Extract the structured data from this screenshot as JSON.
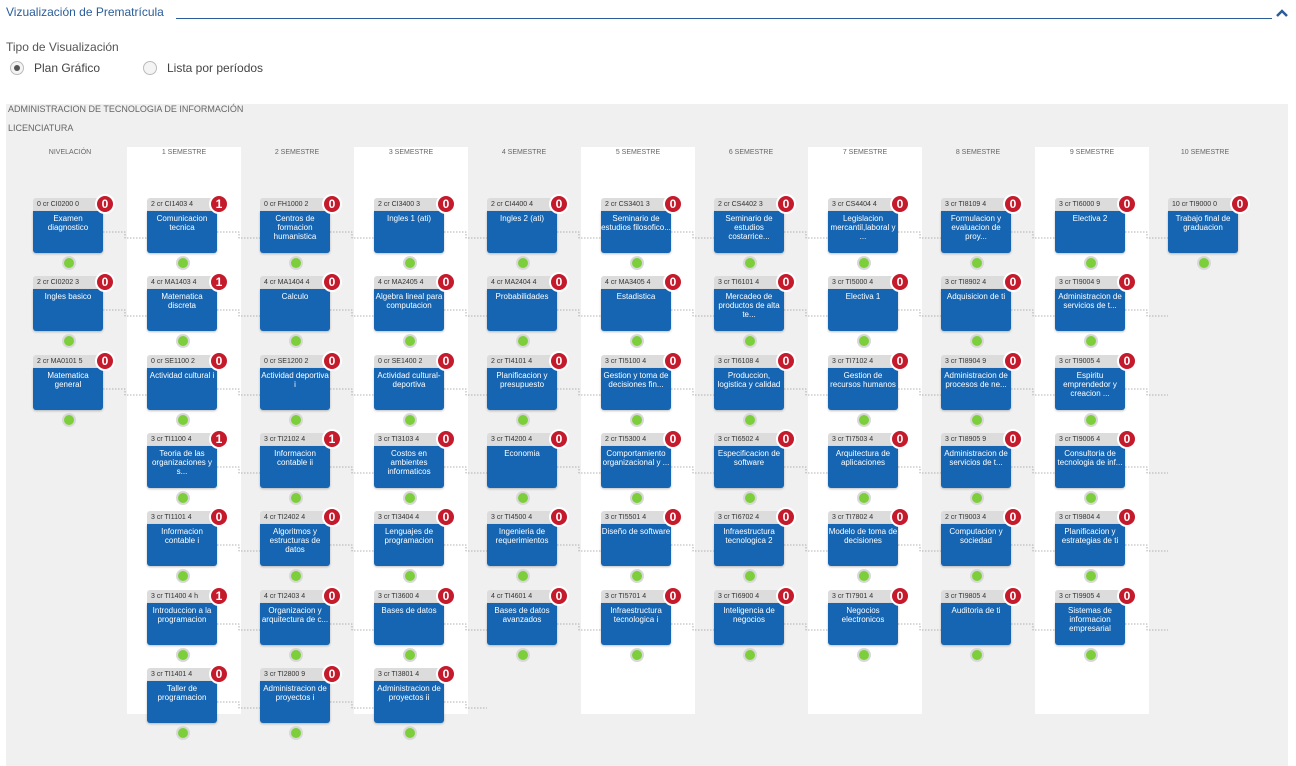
{
  "section": {
    "title": "Vizualización de Prematrícula"
  },
  "visualization": {
    "label": "Tipo de Visualización",
    "options": [
      {
        "label": "Plan Gráfico",
        "checked": true
      },
      {
        "label": "Lista por períodos",
        "checked": false
      }
    ]
  },
  "plan": {
    "name": "ADMINISTRACION DE TECNOLOGIA DE INFORMACIÓN",
    "level": "LICENCIATURA",
    "columns": [
      "NIVELACIÓN",
      "1 SEMESTRE",
      "2 SEMESTRE",
      "3 SEMESTRE",
      "4 SEMESTRE",
      "5 SEMESTRE",
      "6 SEMESTRE",
      "7 SEMESTRE",
      "8 SEMESTRE",
      "9 SEMESTRE",
      "10 SEMESTRE"
    ],
    "courses": [
      {
        "col": 0,
        "row": 0,
        "code": "0 cr  CI0200  0",
        "name": "Examen diagnostico",
        "badge": "0"
      },
      {
        "col": 0,
        "row": 1,
        "code": "2 cr  CI0202  3",
        "name": "Ingles basico",
        "badge": "0"
      },
      {
        "col": 0,
        "row": 2,
        "code": "2 cr  MA0101  5",
        "name": "Matematica general",
        "badge": "0"
      },
      {
        "col": 1,
        "row": 0,
        "code": "2 cr  CI1403  4",
        "name": "Comunicacion tecnica",
        "badge": "1"
      },
      {
        "col": 1,
        "row": 1,
        "code": "4 cr  MA1403  4",
        "name": "Matematica discreta",
        "badge": "1"
      },
      {
        "col": 1,
        "row": 2,
        "code": "0 cr  SE1100  2",
        "name": "Actividad cultural i",
        "badge": "0"
      },
      {
        "col": 1,
        "row": 3,
        "code": "3 cr  TI1100  4",
        "name": "Teoria de las organizaciones y s...",
        "badge": "1"
      },
      {
        "col": 1,
        "row": 4,
        "code": "3 cr  TI1101  4",
        "name": "Informacion contable i",
        "badge": "0"
      },
      {
        "col": 1,
        "row": 5,
        "code": "3 cr  TI1400  4 h",
        "name": "Introduccion a la programacion",
        "badge": "1"
      },
      {
        "col": 1,
        "row": 6,
        "code": "3 cr  TI1401  4",
        "name": "Taller de programacion",
        "badge": "0"
      },
      {
        "col": 2,
        "row": 0,
        "code": "0 cr  FH1000  2",
        "name": "Centros de formacion humanistica",
        "badge": "0"
      },
      {
        "col": 2,
        "row": 1,
        "code": "4 cr  MA1404  4",
        "name": "Calculo",
        "badge": "0"
      },
      {
        "col": 2,
        "row": 2,
        "code": "0 cr  SE1200  2",
        "name": "Actividad deportiva i",
        "badge": "0"
      },
      {
        "col": 2,
        "row": 3,
        "code": "3 cr  TI2102  4",
        "name": "Informacion contable ii",
        "badge": "1"
      },
      {
        "col": 2,
        "row": 4,
        "code": "4 cr  TI2402  4",
        "name": "Algoritmos y estructuras de datos",
        "badge": "0"
      },
      {
        "col": 2,
        "row": 5,
        "code": "4 cr  TI2403  4",
        "name": "Organizacion y arquitectura de c...",
        "badge": "0"
      },
      {
        "col": 2,
        "row": 6,
        "code": "3 cr  TI2800  9",
        "name": "Administracion de proyectos i",
        "badge": "0"
      },
      {
        "col": 3,
        "row": 0,
        "code": "2 cr  CI3400  3",
        "name": "Ingles 1 (ati)",
        "badge": "0"
      },
      {
        "col": 3,
        "row": 1,
        "code": "4 cr  MA2405  4",
        "name": "Algebra lineal para computacion",
        "badge": "0"
      },
      {
        "col": 3,
        "row": 2,
        "code": "0 cr  SE1400  2",
        "name": "Actividad cultural-deportiva",
        "badge": "0"
      },
      {
        "col": 3,
        "row": 3,
        "code": "3 cr  TI3103  4",
        "name": "Costos en ambientes informaticos",
        "badge": "0"
      },
      {
        "col": 3,
        "row": 4,
        "code": "3 cr  TI3404  4",
        "name": "Lenguajes de programacion",
        "badge": "0"
      },
      {
        "col": 3,
        "row": 5,
        "code": "3 cr  TI3600  4",
        "name": "Bases de datos",
        "badge": "0"
      },
      {
        "col": 3,
        "row": 6,
        "code": "3 cr  TI3801  4",
        "name": "Administracion de proyectos ii",
        "badge": "0"
      },
      {
        "col": 4,
        "row": 0,
        "code": "2 cr  CI4400  4",
        "name": "Ingles 2 (ati)",
        "badge": "0"
      },
      {
        "col": 4,
        "row": 1,
        "code": "4 cr  MA2404  4",
        "name": "Probabilidades",
        "badge": "0"
      },
      {
        "col": 4,
        "row": 2,
        "code": "2 cr  TI4101  4",
        "name": "Planificacion y presupuesto",
        "badge": "0"
      },
      {
        "col": 4,
        "row": 3,
        "code": "3 cr  TI4200  4",
        "name": "Economia",
        "badge": "0"
      },
      {
        "col": 4,
        "row": 4,
        "code": "3 cr  TI4500  4",
        "name": "Ingenieria de requerimientos",
        "badge": "0"
      },
      {
        "col": 4,
        "row": 5,
        "code": "4 cr  TI4601  4",
        "name": "Bases de datos avanzados",
        "badge": "0"
      },
      {
        "col": 5,
        "row": 0,
        "code": "2 cr  CS3401  3",
        "name": "Seminario de estudios filosofico...",
        "badge": "0"
      },
      {
        "col": 5,
        "row": 1,
        "code": "4 cr  MA3405  4",
        "name": "Estadistica",
        "badge": "0"
      },
      {
        "col": 5,
        "row": 2,
        "code": "3 cr  TI5100  4",
        "name": "Gestion y toma de decisiones fin...",
        "badge": "0"
      },
      {
        "col": 5,
        "row": 3,
        "code": "2 cr  TI5300  4",
        "name": "Comportamiento organizacional y ...",
        "badge": "0"
      },
      {
        "col": 5,
        "row": 4,
        "code": "3 cr  TI5501  4",
        "name": "Diseño de software",
        "badge": "0"
      },
      {
        "col": 5,
        "row": 5,
        "code": "3 cr  TI5701  4",
        "name": "Infraestructura tecnologica i",
        "badge": "0"
      },
      {
        "col": 6,
        "row": 0,
        "code": "2 cr  CS4402  3",
        "name": "Seminario de estudios costarrice...",
        "badge": "0"
      },
      {
        "col": 6,
        "row": 1,
        "code": "3 cr  TI6101  4",
        "name": "Mercadeo de productos de alta te...",
        "badge": "0"
      },
      {
        "col": 6,
        "row": 2,
        "code": "3 cr  TI6108  4",
        "name": "Produccion, logistica y calidad",
        "badge": "0"
      },
      {
        "col": 6,
        "row": 3,
        "code": "3 cr  TI6502  4",
        "name": "Especificacion de software",
        "badge": "0"
      },
      {
        "col": 6,
        "row": 4,
        "code": "3 cr  TI6702  4",
        "name": "Infraestructura tecnologica 2",
        "badge": "0"
      },
      {
        "col": 6,
        "row": 5,
        "code": "3 cr  TI6900  4",
        "name": "Inteligencia de negocios",
        "badge": "0"
      },
      {
        "col": 7,
        "row": 0,
        "code": "3 cr  CS4404  4",
        "name": "Legislacion mercantil,laboral y ...",
        "badge": "0"
      },
      {
        "col": 7,
        "row": 1,
        "code": "3 cr  TI5000  4",
        "name": "Electiva 1",
        "badge": "0"
      },
      {
        "col": 7,
        "row": 2,
        "code": "3 cr  TI7102  4",
        "name": "Gestion de recursos humanos",
        "badge": "0"
      },
      {
        "col": 7,
        "row": 3,
        "code": "3 cr  TI7503  4",
        "name": "Arquitectura de aplicaciones",
        "badge": "0"
      },
      {
        "col": 7,
        "row": 4,
        "code": "3 cr  TI7802  4",
        "name": "Modelo de toma de decisiones",
        "badge": "0"
      },
      {
        "col": 7,
        "row": 5,
        "code": "3 cr  TI7901  4",
        "name": "Negocios electronicos",
        "badge": "0"
      },
      {
        "col": 8,
        "row": 0,
        "code": "3 cr  TI8109  4",
        "name": "Formulacion y evaluacion de proy...",
        "badge": "0"
      },
      {
        "col": 8,
        "row": 1,
        "code": "3 cr  TI8902  4",
        "name": "Adquisicion de ti",
        "badge": "0"
      },
      {
        "col": 8,
        "row": 2,
        "code": "3 cr  TI8904  9",
        "name": "Administracion de procesos de ne...",
        "badge": "0"
      },
      {
        "col": 8,
        "row": 3,
        "code": "3 cr  TI8905  9",
        "name": "Administracion de servicios de t...",
        "badge": "0"
      },
      {
        "col": 8,
        "row": 4,
        "code": "2 cr  TI9003  4",
        "name": "Computacion y sociedad",
        "badge": "0"
      },
      {
        "col": 8,
        "row": 5,
        "code": "3 cr  TI9805  4",
        "name": "Auditoria de ti",
        "badge": "0"
      },
      {
        "col": 9,
        "row": 0,
        "code": "3 cr  TI6000  9",
        "name": "Electiva 2",
        "badge": "0"
      },
      {
        "col": 9,
        "row": 1,
        "code": "3 cr  TI9004  9",
        "name": "Administracion de servicios de t...",
        "badge": "0"
      },
      {
        "col": 9,
        "row": 2,
        "code": "3 cr  TI9005  4",
        "name": "Espiritu emprendedor y creacion ...",
        "badge": "0"
      },
      {
        "col": 9,
        "row": 3,
        "code": "3 cr  TI9006  4",
        "name": "Consultoria de tecnologia de inf...",
        "badge": "0"
      },
      {
        "col": 9,
        "row": 4,
        "code": "3 cr  TI9804  4",
        "name": "Planificacion y estrategias de ti",
        "badge": "0"
      },
      {
        "col": 9,
        "row": 5,
        "code": "3 cr  TI9905  4",
        "name": "Sistemas de informacion empresarial",
        "badge": "0"
      },
      {
        "col": 10,
        "row": 0,
        "code": "10 cr  TI9000  0",
        "name": "Trabajo final de graduacion",
        "badge": "0"
      }
    ]
  },
  "colors": {
    "course_blue": "#1565b2",
    "badge_red": "#c41a2b",
    "status_green": "#7ccf3a",
    "header_blue": "#2a5d9a"
  },
  "icons": {
    "collapse": "chevron-up-icon"
  }
}
